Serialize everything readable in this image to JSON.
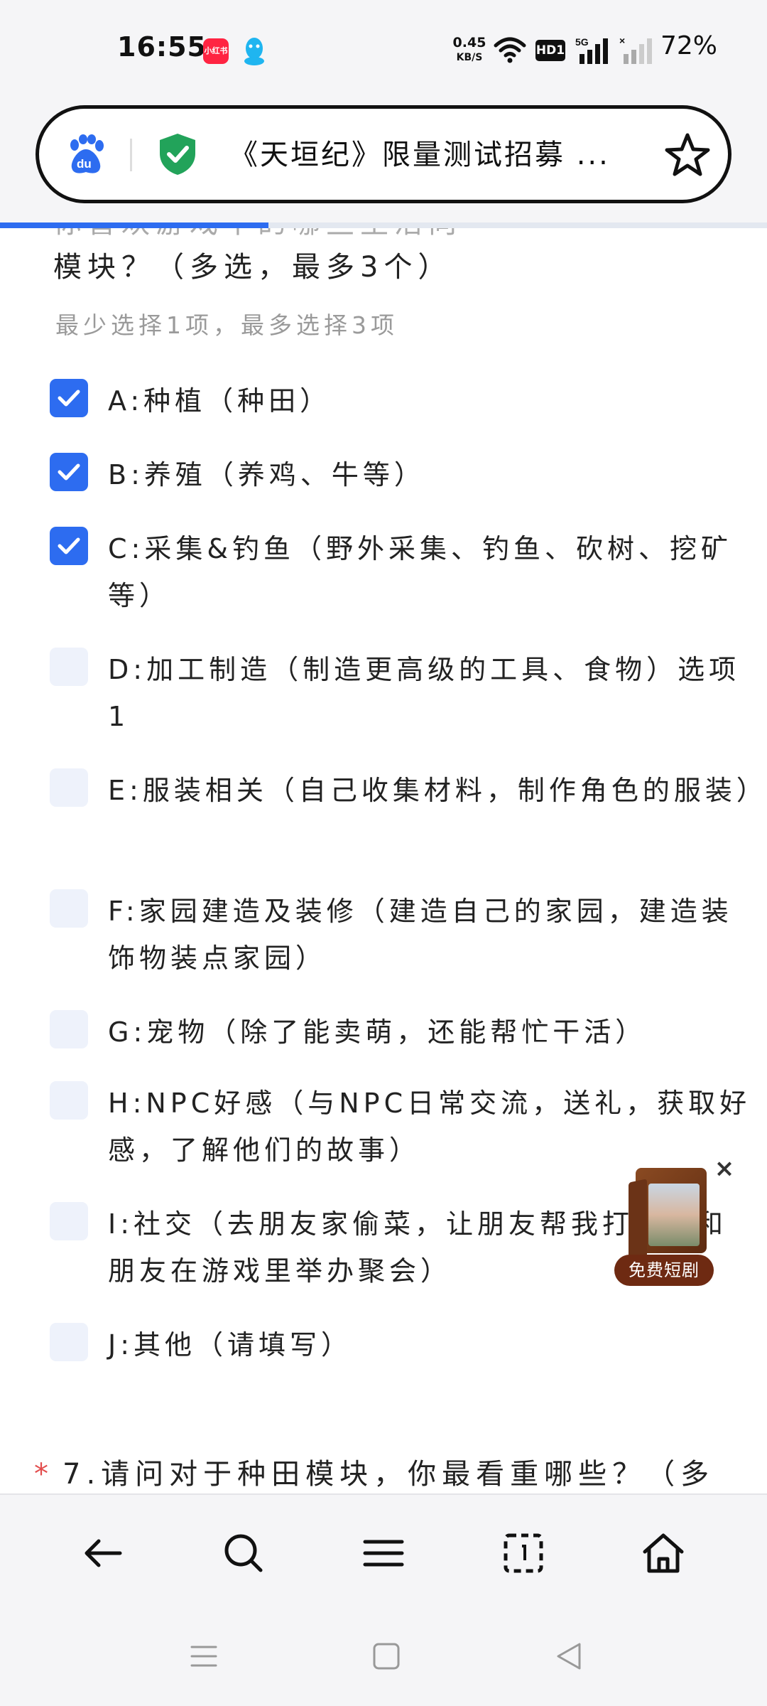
{
  "status_bar": {
    "time": "16:55",
    "app_badge": "小红书",
    "net_speed_value": "0.45",
    "net_speed_unit": "KB/S",
    "hd_label": "HD1",
    "signal_label": "5G",
    "battery": "72%"
  },
  "address_bar": {
    "title": "《天垣纪》限量测试招募 ..."
  },
  "progress": {
    "fraction": 0.35,
    "color": "#2d6cf0"
  },
  "question6": {
    "title_cut": "你喜欢游戏中的哪些生活向",
    "title": "模块？（多选，最多3个）",
    "hint": "最少选择1项，最多选择3项",
    "options": [
      {
        "text": "A:种植（种田）",
        "checked": true
      },
      {
        "text": "B:养殖（养鸡、牛等）",
        "checked": true
      },
      {
        "text": "C:采集&钓鱼（野外采集、钓鱼、砍树、挖矿等）",
        "checked": true
      },
      {
        "text": "D:加工制造（制造更高级的工具、食物）选项1",
        "checked": false
      },
      {
        "text": "E:服装相关（自己收集材料，制作角色的服装）",
        "checked": false
      },
      {
        "text": "F:家园建造及装修（建造自己的家园，建造装饰物装点家园）",
        "checked": false
      },
      {
        "text": "G:宠物（除了能卖萌，还能帮忙干活）",
        "checked": false
      },
      {
        "text": "H:NPC好感（与NPC日常交流，送礼，获取好感，了解他们的故事）",
        "checked": false
      },
      {
        "text": "I:社交（去朋友家偷菜，让朋友帮我打工，和朋友在游戏里举办聚会）",
        "checked": false
      },
      {
        "text": "J:其他（请填写）",
        "checked": false
      }
    ]
  },
  "question7": {
    "required_mark": "*",
    "title": "7.请问对于种田模块，你最看重哪些？（多"
  },
  "ad": {
    "label": "免费短剧",
    "close": "×"
  },
  "colors": {
    "accent": "#2d6cf0",
    "shield": "#22a35a",
    "baidu": "#2d6cf0"
  },
  "toolbar_icons": [
    "back-arrow-icon",
    "search-icon",
    "menu-icon",
    "tabs-icon",
    "home-icon"
  ],
  "nav_icons": [
    "recent-apps-icon",
    "home-square-icon",
    "back-triangle-icon"
  ]
}
